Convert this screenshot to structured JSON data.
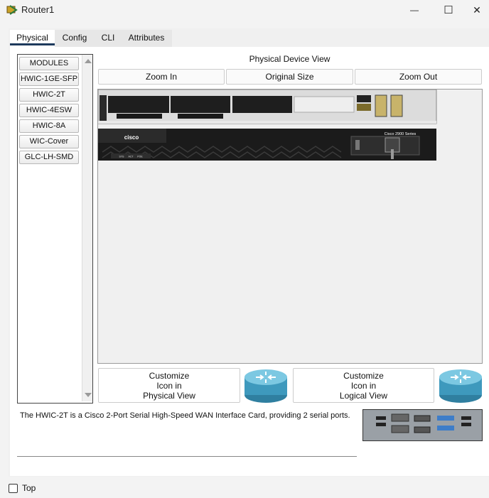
{
  "window": {
    "title": "Router1",
    "minimize_glyph": "—",
    "maximize_glyph": "☐",
    "close_glyph": "✕"
  },
  "tabs": [
    {
      "label": "Physical",
      "active": true
    },
    {
      "label": "Config",
      "active": false
    },
    {
      "label": "CLI",
      "active": false
    },
    {
      "label": "Attributes",
      "active": false
    }
  ],
  "modules": [
    "MODULES",
    "HWIC-1GE-SFP",
    "HWIC-2T",
    "HWIC-4ESW",
    "HWIC-8A",
    "WIC-Cover",
    "GLC-LH-SMD"
  ],
  "physical_view": {
    "title": "Physical Device View",
    "zoom_in": "Zoom In",
    "original_size": "Original Size",
    "zoom_out": "Zoom Out",
    "brand": "cisco",
    "series": "Cisco 2900 Series",
    "leds": [
      "SYS",
      "ACT",
      "POE"
    ]
  },
  "customize": {
    "physical": [
      "Customize",
      "Icon in",
      "Physical View"
    ],
    "logical": [
      "Customize",
      "Icon in",
      "Logical View"
    ]
  },
  "description": "The HWIC-2T is a Cisco 2-Port Serial High-Speed WAN Interface Card, providing 2 serial ports.",
  "footer": {
    "top_label": "Top"
  },
  "icons": {
    "app": "router-app-icon",
    "router": "router-icon",
    "scroll_up": "scroll-up-icon",
    "scroll_down": "scroll-down-icon"
  },
  "colors": {
    "accent": "#1d3a5c",
    "router_blue": "#4aa8c8",
    "chassis_dark": "#1b1b1b"
  }
}
